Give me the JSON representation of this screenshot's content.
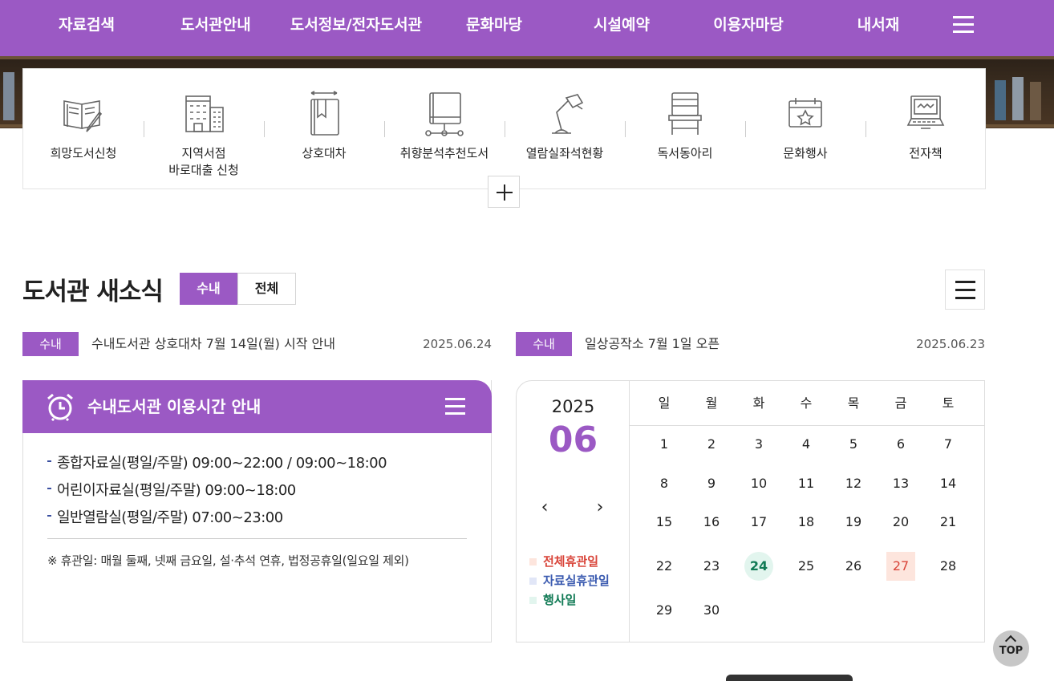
{
  "nav": {
    "items": [
      "자료검색",
      "도서관안내",
      "도서정보/전자도서관",
      "문화마당",
      "시설예약",
      "이용자마당",
      "내서재"
    ],
    "menu_icon": "hamburger-icon"
  },
  "quick_menu": {
    "items": [
      {
        "label": "희망도서신청",
        "icon": "open-book-pencil-icon"
      },
      {
        "label": "지역서점\n바로대출 신청",
        "icon": "bookstore-building-icon"
      },
      {
        "label": "상호대차",
        "icon": "book-exchange-icon"
      },
      {
        "label": "취향분석추천도서",
        "icon": "book-network-icon"
      },
      {
        "label": "열람실좌석현황",
        "icon": "desk-lamp-icon"
      },
      {
        "label": "독서동아리",
        "icon": "chair-icon"
      },
      {
        "label": "문화행사",
        "icon": "event-calendar-star-icon"
      },
      {
        "label": "전자책",
        "icon": "laptop-icon"
      }
    ],
    "more_icon": "plus-icon"
  },
  "news": {
    "title": "도서관 새소식",
    "tabs": [
      "수내",
      "전체"
    ],
    "active_tab": "수내",
    "items": [
      {
        "badge": "수내",
        "text": "수내도서관 상호대차 7월 14일(월) 시작 안내",
        "date": "2025.06.24"
      },
      {
        "badge": "수내",
        "text": "일상공작소 7월 1일 오픈",
        "date": "2025.06.23"
      }
    ]
  },
  "hours": {
    "title": "수내도서관 이용시간 안내",
    "lines": [
      "종합자료실(평일/주말) 09:00~22:00 / 09:00~18:00",
      "어린이자료실(평일/주말) 09:00~18:00",
      "일반열람실(평일/주말) 07:00~23:00"
    ],
    "note": "※ 휴관일: 매월 둘째, 넷째 금요일, 설·추석 연휴, 법정공휴일(일요일 제외)"
  },
  "calendar": {
    "year": "2025",
    "month": "06",
    "prev": "‹",
    "next": "›",
    "weekdays": [
      "일",
      "월",
      "화",
      "수",
      "목",
      "금",
      "토"
    ],
    "weeks": [
      [
        "1",
        "2",
        "3",
        "4",
        "5",
        "6",
        "7"
      ],
      [
        "8",
        "9",
        "10",
        "11",
        "12",
        "13",
        "14"
      ],
      [
        "15",
        "16",
        "17",
        "18",
        "19",
        "20",
        "21"
      ],
      [
        "22",
        "23",
        "24",
        "25",
        "26",
        "27",
        "28"
      ],
      [
        "29",
        "30",
        "",
        "",
        "",
        "",
        ""
      ]
    ],
    "event_days": [
      "24"
    ],
    "closed_days": [
      "27"
    ],
    "legend": [
      {
        "label": "전체휴관일",
        "color": "#d9453a",
        "swatch": "#fde5dd"
      },
      {
        "label": "자료실휴관일",
        "color": "#3b5bb0",
        "swatch": "#e1e6f7"
      },
      {
        "label": "행사일",
        "color": "#117a55",
        "swatch": "#e2f5ee"
      }
    ]
  },
  "top_button": "TOP",
  "colors": {
    "accent": "#9b59c4"
  }
}
